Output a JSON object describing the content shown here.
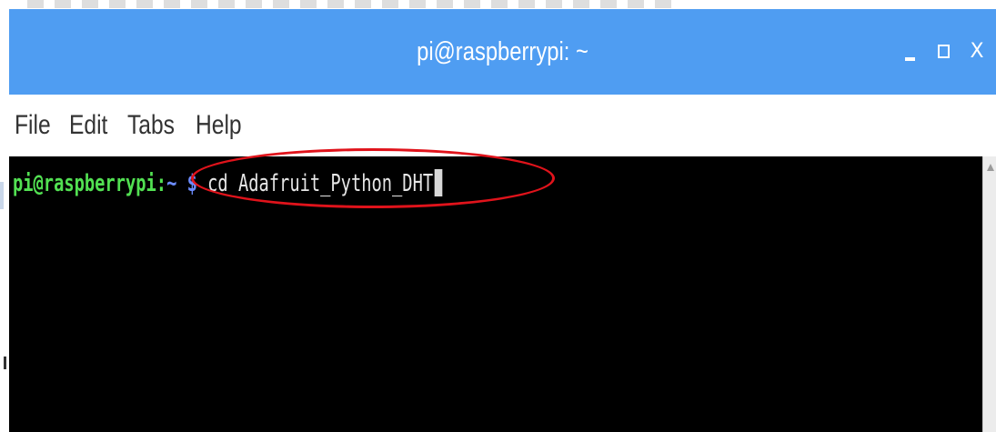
{
  "window": {
    "title": "pi@raspberrypi: ~",
    "controls": {
      "minimize_icon": "minimize-icon",
      "maximize_icon": "maximize-icon",
      "close_label": "X"
    },
    "titlebar_color": "#4f9df2"
  },
  "menubar": {
    "items": [
      {
        "label": "File"
      },
      {
        "label": "Edit"
      },
      {
        "label": "Tabs"
      },
      {
        "label": "Help"
      }
    ]
  },
  "terminal": {
    "prompt_user": "pi@raspberrypi",
    "prompt_sep": ":",
    "prompt_path": "~",
    "prompt_symbol": "$",
    "command": "cd Adafruit_Python_DHT",
    "background": "#000000",
    "prompt_color": "#52e052",
    "path_color": "#6c8cff"
  },
  "annotation": {
    "type": "ellipse",
    "color": "#e0131b"
  }
}
